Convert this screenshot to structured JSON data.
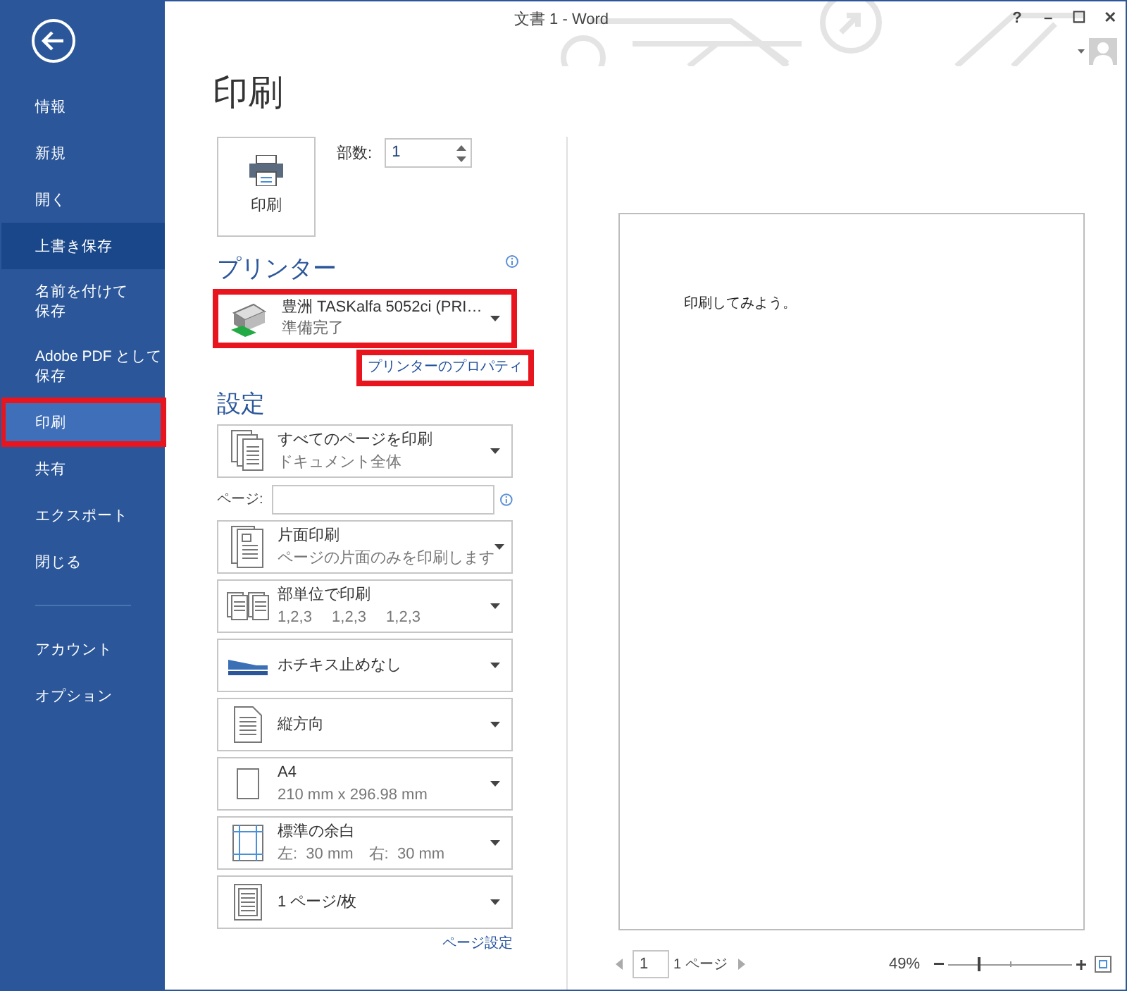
{
  "window": {
    "title": "文書 1 - Word",
    "controls": [
      "?",
      "–",
      "☐",
      "✕"
    ]
  },
  "sidebar": {
    "items": [
      {
        "label": "情報",
        "selected": false,
        "highlighted": false,
        "annotated": false
      },
      {
        "label": "新規",
        "selected": false,
        "highlighted": false,
        "annotated": false
      },
      {
        "label": "開く",
        "selected": false,
        "highlighted": false,
        "annotated": false
      },
      {
        "label": "上書き保存",
        "selected": false,
        "highlighted": true,
        "annotated": false
      },
      {
        "lines": [
          "名前を付けて",
          "保存"
        ],
        "selected": false,
        "highlighted": false,
        "annotated": false
      },
      {
        "lines": [
          "Adobe PDF として",
          "保存"
        ],
        "selected": false,
        "highlighted": false,
        "annotated": false
      },
      {
        "label": "印刷",
        "selected": true,
        "highlighted": false,
        "annotated": true
      },
      {
        "label": "共有",
        "selected": false,
        "highlighted": false,
        "annotated": false
      },
      {
        "label": "エクスポート",
        "selected": false,
        "highlighted": false,
        "annotated": false
      },
      {
        "label": "閉じる",
        "selected": false,
        "highlighted": false,
        "annotated": false
      },
      {
        "label": "アカウント",
        "selected": false,
        "highlighted": false,
        "annotated": false,
        "divider_before": true
      },
      {
        "label": "オプション",
        "selected": false,
        "highlighted": false,
        "annotated": false
      }
    ]
  },
  "heading": "印刷",
  "print_button": {
    "label": "印刷"
  },
  "copies": {
    "label": "部数:",
    "value": "1"
  },
  "printer": {
    "heading": "プリンター",
    "name": "豊洲 TASKalfa 5052ci (PRI…",
    "status": "準備完了",
    "annotated": true,
    "properties_link": {
      "label": "プリンターのプロパティ",
      "annotated": true
    }
  },
  "settings": {
    "heading": "設定",
    "items": [
      {
        "kind": "pages",
        "line1": "すべてのページを印刷",
        "line2": "ドキュメント全体"
      },
      {
        "kind": "page_field",
        "label": "ページ:"
      },
      {
        "kind": "sides",
        "line1": "片面印刷",
        "line2": "ページの片面のみを印刷します"
      },
      {
        "kind": "collate",
        "line1": "部単位で印刷",
        "line2": "1,2,3　 1,2,3　 1,2,3"
      },
      {
        "kind": "staple",
        "line1": "ホチキス止めなし"
      },
      {
        "kind": "orientation",
        "line1": "縦方向"
      },
      {
        "kind": "paper",
        "line1": "A4",
        "line2": "210 mm x 296.98 mm"
      },
      {
        "kind": "margins",
        "line1": "標準の余白",
        "line2": "左:  30 mm　右:  30 mm"
      },
      {
        "kind": "per_sheet",
        "line1": "1 ページ/枚"
      }
    ],
    "page_setup_link": "ページ設定"
  },
  "preview": {
    "text": "印刷してみよう。",
    "page_value": "1",
    "page_total": "1 ページ",
    "zoom": "49%",
    "zoom_slider": {
      "level": 0.24
    }
  }
}
